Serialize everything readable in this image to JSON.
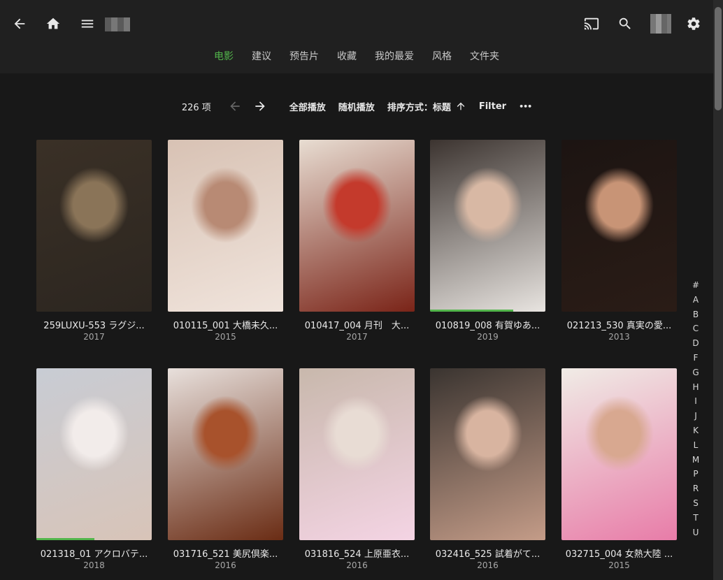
{
  "header": {
    "tabs": [
      {
        "label": "电影",
        "active": true
      },
      {
        "label": "建议",
        "active": false
      },
      {
        "label": "预告片",
        "active": false
      },
      {
        "label": "收藏",
        "active": false
      },
      {
        "label": "我的最爱",
        "active": false
      },
      {
        "label": "风格",
        "active": false
      },
      {
        "label": "文件夹",
        "active": false
      }
    ],
    "icons": [
      "back-arrow-icon",
      "home-icon",
      "menu-icon",
      "cast-icon",
      "search-icon",
      "gear-icon"
    ]
  },
  "toolbar": {
    "count": "226 项",
    "play_all": "全部播放",
    "shuffle": "随机播放",
    "sort_label": "排序方式：标题",
    "filter": "Filter",
    "more": "•••"
  },
  "movies": [
    {
      "title": "259LUXU-553 ラグジ...",
      "year": "2017",
      "colors": [
        "#3a3026",
        "#8a7458",
        "#2c2620"
      ],
      "progress": 0
    },
    {
      "title": "010115_001 大橋未久...",
      "year": "2015",
      "colors": [
        "#d8c2b4",
        "#b88a74",
        "#f0e4dc"
      ],
      "progress": 0
    },
    {
      "title": "010417_004 月刊　大...",
      "year": "2017",
      "colors": [
        "#e8ddd2",
        "#c43a2c",
        "#7a2418"
      ],
      "progress": 0
    },
    {
      "title": "010819_008 有賀ゆあ...",
      "year": "2019",
      "colors": [
        "#3c3430",
        "#d8b8a4",
        "#e8e4e0"
      ],
      "progress": 0.72
    },
    {
      "title": "021213_530 真実の愛...",
      "year": "2013",
      "colors": [
        "#1c1412",
        "#c89476",
        "#2a1c16"
      ],
      "progress": 0
    },
    {
      "title": "021318_01 アクロバテ...",
      "year": "2018",
      "colors": [
        "#c8ccd4",
        "#f2ecea",
        "#d8c4b8"
      ],
      "progress": 0.5
    },
    {
      "title": "031716_521 美尻倶楽...",
      "year": "2016",
      "colors": [
        "#e8e0dc",
        "#a8522c",
        "#6a2c14"
      ],
      "progress": 0
    },
    {
      "title": "031816_524 上原亜衣...",
      "year": "2016",
      "colors": [
        "#c8b8ac",
        "#e8dcd4",
        "#f4d4e4"
      ],
      "progress": 0
    },
    {
      "title": "032416_525 試着がて...",
      "year": "2016",
      "colors": [
        "#3a3430",
        "#d8b4a0",
        "#c49c88"
      ],
      "progress": 0
    },
    {
      "title": "032715_004 女熱大陸 ...",
      "year": "2015",
      "colors": [
        "#f0ece6",
        "#d8a890",
        "#e87ca8"
      ],
      "progress": 0
    }
  ],
  "alphabet": [
    "#",
    "A",
    "B",
    "C",
    "D",
    "F",
    "G",
    "H",
    "I",
    "J",
    "K",
    "L",
    "M",
    "P",
    "R",
    "S",
    "T",
    "U"
  ],
  "accent_color": "#52b54b"
}
